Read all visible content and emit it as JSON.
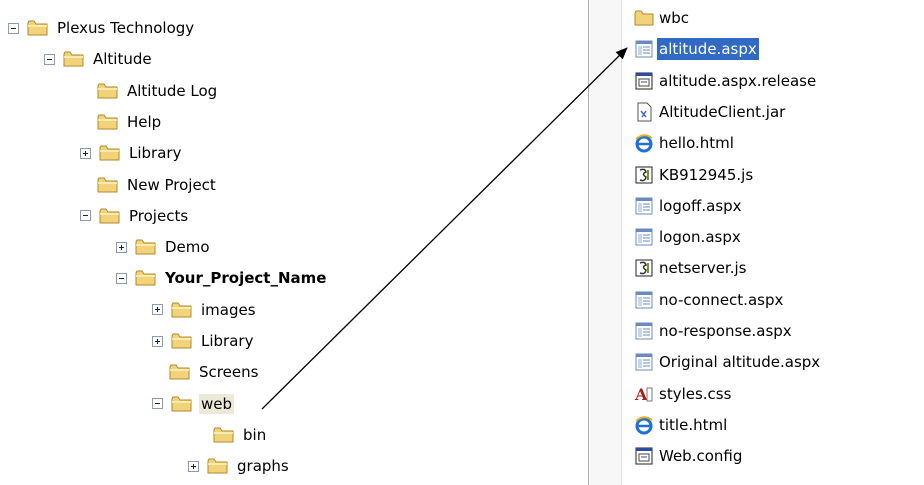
{
  "tree": [
    {
      "label": "Plexus Technology",
      "depth": 0,
      "expander": "minus",
      "bold": false,
      "highlight": false
    },
    {
      "label": "Altitude",
      "depth": 1,
      "expander": "minus",
      "bold": false,
      "highlight": false
    },
    {
      "label": "Altitude Log",
      "depth": 2,
      "expander": "none",
      "bold": false,
      "highlight": false
    },
    {
      "label": "Help",
      "depth": 2,
      "expander": "none",
      "bold": false,
      "highlight": false
    },
    {
      "label": "Library",
      "depth": 2,
      "expander": "plus",
      "bold": false,
      "highlight": false
    },
    {
      "label": "New Project",
      "depth": 2,
      "expander": "none",
      "bold": false,
      "highlight": false
    },
    {
      "label": "Projects",
      "depth": 2,
      "expander": "minus",
      "bold": false,
      "highlight": false
    },
    {
      "label": "Demo",
      "depth": 3,
      "expander": "plus",
      "bold": false,
      "highlight": false
    },
    {
      "label": "Your_Project_Name",
      "depth": 3,
      "expander": "minus",
      "bold": true,
      "highlight": false
    },
    {
      "label": "images",
      "depth": 4,
      "expander": "plus",
      "bold": false,
      "highlight": false
    },
    {
      "label": "Library",
      "depth": 4,
      "expander": "plus",
      "bold": false,
      "highlight": false
    },
    {
      "label": "Screens",
      "depth": 4,
      "expander": "none",
      "bold": false,
      "highlight": false
    },
    {
      "label": "web",
      "depth": 4,
      "expander": "minus",
      "bold": false,
      "highlight": true
    },
    {
      "label": "bin",
      "depth": 5,
      "expander": "none",
      "bold": false,
      "highlight": false
    },
    {
      "label": "graphs",
      "depth": 5,
      "expander": "plus",
      "bold": false,
      "highlight": false
    }
  ],
  "files": [
    {
      "label": "wbc",
      "icon": "folder-icon",
      "selected": false
    },
    {
      "label": "altitude.aspx",
      "icon": "aspx-page-icon",
      "selected": true
    },
    {
      "label": "altitude.aspx.release",
      "icon": "config-file-icon",
      "selected": false
    },
    {
      "label": "AltitudeClient.jar",
      "icon": "jar-file-icon",
      "selected": false
    },
    {
      "label": "hello.html",
      "icon": "ie-html-icon",
      "selected": false
    },
    {
      "label": "KB912945.js",
      "icon": "script-file-icon",
      "selected": false
    },
    {
      "label": "logoff.aspx",
      "icon": "aspx-page-icon",
      "selected": false
    },
    {
      "label": "logon.aspx",
      "icon": "aspx-page-icon",
      "selected": false
    },
    {
      "label": "netserver.js",
      "icon": "script-file-icon",
      "selected": false
    },
    {
      "label": "no-connect.aspx",
      "icon": "aspx-page-icon",
      "selected": false
    },
    {
      "label": "no-response.aspx",
      "icon": "aspx-page-icon",
      "selected": false
    },
    {
      "label": "Original altitude.aspx",
      "icon": "aspx-page-icon",
      "selected": false
    },
    {
      "label": "styles.css",
      "icon": "css-file-icon",
      "selected": false
    },
    {
      "label": "title.html",
      "icon": "ie-html-icon",
      "selected": false
    },
    {
      "label": "Web.config",
      "icon": "config-file-icon",
      "selected": false
    }
  ],
  "colors": {
    "selection": "#316ac5",
    "folder": "#f3d37a",
    "arrow": "#000000"
  }
}
